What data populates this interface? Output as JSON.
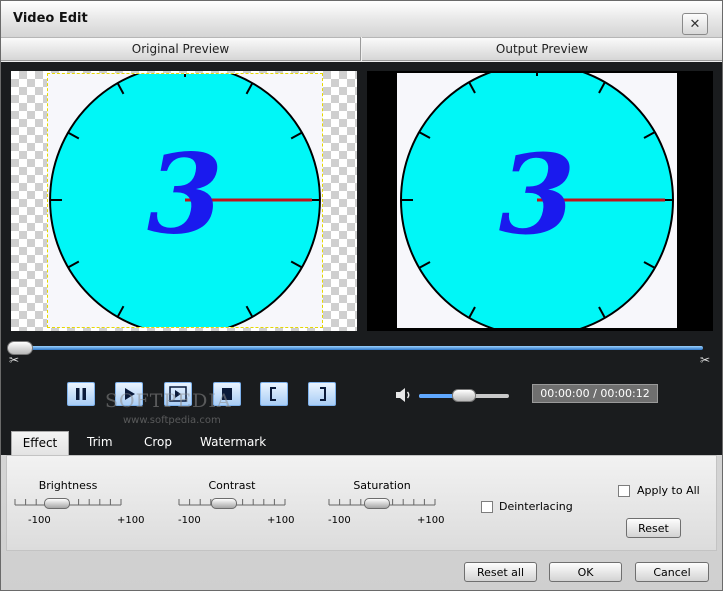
{
  "window": {
    "title": "Video Edit"
  },
  "preview": {
    "original_label": "Original Preview",
    "output_label": "Output Preview"
  },
  "clock": {
    "digit": "3"
  },
  "player": {
    "time": "00:00:00 / 00:00:12",
    "volume_level": 0.5,
    "timeline_position": 0.0
  },
  "watermark": {
    "main": "SOFTPEDIA",
    "sub": "www.softpedia.com"
  },
  "tabs": [
    {
      "label": "Effect"
    },
    {
      "label": "Trim"
    },
    {
      "label": "Crop"
    },
    {
      "label": "Watermark"
    }
  ],
  "effect": {
    "brightness": {
      "label": "Brightness",
      "min": "-100",
      "max": "+100",
      "value": -20
    },
    "contrast": {
      "label": "Contrast",
      "min": "-100",
      "max": "+100",
      "value": -15
    },
    "saturation": {
      "label": "Saturation",
      "min": "-100",
      "max": "+100",
      "value": -10
    },
    "deinterlacing_label": "Deinterlacing",
    "apply_all_label": "Apply to All",
    "reset_label": "Reset"
  },
  "footer": {
    "reset_all": "Reset all",
    "ok": "OK",
    "cancel": "Cancel"
  },
  "colors": {
    "clock_face": "#00f7f7",
    "digit": "#1a1aee",
    "hand": "#c0141c",
    "accent": "#5fa8ff"
  }
}
